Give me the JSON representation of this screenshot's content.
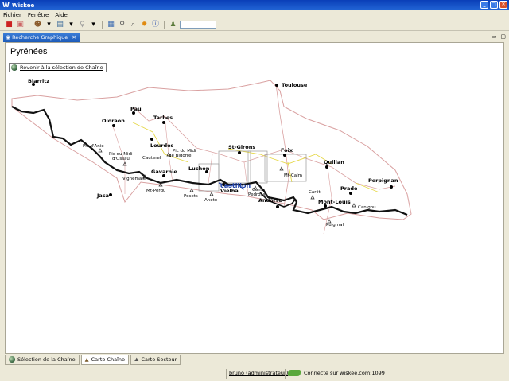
{
  "window": {
    "title": "Wiskee"
  },
  "menu": [
    {
      "label": "Fichier"
    },
    {
      "label": "Fenêtre"
    },
    {
      "label": "Aide"
    }
  ],
  "view_tab": {
    "label": "Recherche Graphique"
  },
  "page": {
    "title": "Pyrénées",
    "back_link": "Revenir à la sélection de Chaîne"
  },
  "map": {
    "cities": [
      {
        "name": "Biarritz"
      },
      {
        "name": "Toulouse"
      },
      {
        "name": "Pau"
      },
      {
        "name": "Tarbes"
      },
      {
        "name": "Oloraon"
      },
      {
        "name": "Lourdes"
      },
      {
        "name": "St-Girons"
      },
      {
        "name": "Foix"
      },
      {
        "name": "Quillan"
      },
      {
        "name": "Perpignan"
      },
      {
        "name": "Prade"
      },
      {
        "name": "Mont-Louis"
      },
      {
        "name": "Andorre"
      },
      {
        "name": "Luchon"
      },
      {
        "name": "Vielha"
      },
      {
        "name": "Gavarnie"
      },
      {
        "name": "Jaca"
      },
      {
        "name": "Cauterel"
      }
    ],
    "peaks": [
      {
        "name": "Pic d'Anie"
      },
      {
        "name": "Pic du Midi d'Ossau"
      },
      {
        "name": "Pic du Midi de Bigorre"
      },
      {
        "name": "Vignemale"
      },
      {
        "name": "Mt-Perdu"
      },
      {
        "name": "Posets"
      },
      {
        "name": "Aneto"
      },
      {
        "name": "Mt-Calm"
      },
      {
        "name": "Coma Pedrosa"
      },
      {
        "name": "Carlit"
      },
      {
        "name": "Canigou"
      },
      {
        "name": "Puigmal"
      }
    ],
    "highlight": "castillon",
    "colors": {
      "border": "#111111",
      "roads": "#d9a0a0",
      "yellow_roads": "#e6d84a",
      "highlight": "#2244aa"
    }
  },
  "bottom_tabs": [
    {
      "label": "Sélection de la Chaîne"
    },
    {
      "label": "Carte Chaîne"
    },
    {
      "label": "Carte Secteur"
    }
  ],
  "status": {
    "user": "bruno (administrateur)",
    "connection": "Connecté sur wiskee.com:1099"
  }
}
